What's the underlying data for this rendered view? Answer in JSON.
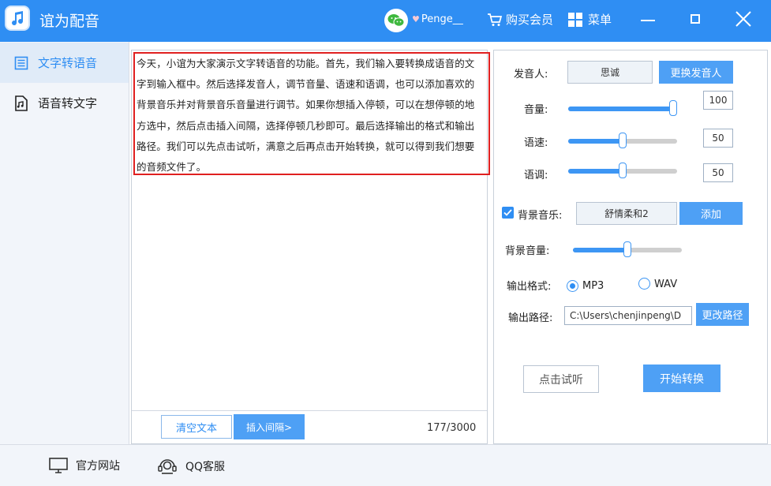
{
  "app": {
    "title": "谊为配音"
  },
  "titlebar": {
    "username": "Penge__",
    "buy_vip": "购买会员",
    "menu": "菜单"
  },
  "sidebar": {
    "items": [
      {
        "label": "文字转语音"
      },
      {
        "label": "语音转文字"
      }
    ]
  },
  "editor": {
    "text_lines": [
      "今天，小谊为大家演示文字转语音的功能。首先，我们输入要转换成语音的文",
      "字到输入框中。然后选择发音人，调节音量、语速和语调，也可以添加喜欢的",
      "背景音乐并对背景音乐音量进行调节。如果你想插入停顿，可以在想停顿的地",
      "方选中，然后点击插入间隔，选择停顿几秒即可。最后选择输出的格式和输出",
      "路径。我们可以先点击试听，满意之后再点击开始转换，就可以得到我们想要",
      "的音频文件了。"
    ],
    "clear_label": "清空文本",
    "insert_label": "插入间隔>",
    "char_count": "177/3000"
  },
  "settings": {
    "speaker_label": "发音人:",
    "speaker_value": "思诚",
    "change_speaker_label": "更换发音人",
    "volume_label": "音量:",
    "volume_value": "100",
    "volume_level": 1.0,
    "speed_label": "语速:",
    "speed_value": "50",
    "speed_level": 0.5,
    "pitch_label": "语调:",
    "pitch_value": "50",
    "pitch_level": 0.5,
    "bgm_label": "背景音乐:",
    "bgm_checked": true,
    "bgm_value": "舒情柔和2",
    "add_label": "添加",
    "bgm_volume_label": "背景音量:",
    "bgm_volume_level": 0.5,
    "format_label": "输出格式:",
    "format_options": [
      "MP3",
      "WAV"
    ],
    "format_selected": "MP3",
    "path_label": "输出路径:",
    "path_value": "C:\\Users\\chenjinpeng\\D",
    "change_path_label": "更改路径",
    "preview_label": "点击试听",
    "start_label": "开始转换"
  },
  "footer": {
    "website": "官方网站",
    "support": "QQ客服"
  },
  "colors": {
    "primary": "#2f8ef3",
    "button": "#4ea0f5",
    "highlight_border": "#e02020"
  }
}
